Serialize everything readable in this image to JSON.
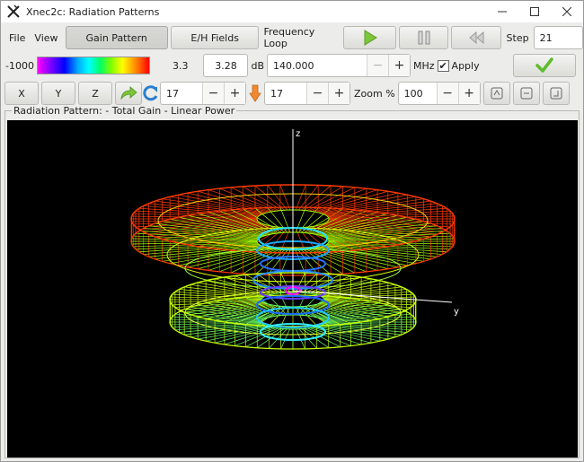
{
  "window": {
    "title": "Xnec2c: Radiation Patterns",
    "app_icon": "xnec2c-icon",
    "controls": [
      "minimize-icon",
      "maximize-icon",
      "close-icon"
    ]
  },
  "menu": {
    "file": "File",
    "view": "View"
  },
  "toolbar": {
    "gain_pattern": "Gain Pattern",
    "eh_fields": "E/H Fields",
    "frequency_loop": "Frequency Loop",
    "play_icon": "play-icon",
    "pause_icon": "pause-icon",
    "rewind_icon": "rewind-icon",
    "step_label": "Step",
    "step_value": "21"
  },
  "scale_row": {
    "min_value": "-1000",
    "max_value": "3.3",
    "gain_value": "3.28",
    "gain_unit": "dB",
    "frequency_value": "140.000",
    "frequency_unit": "MHz",
    "apply_label": "Apply",
    "apply_checked": true,
    "apply_check_mark": "✔",
    "confirm_icon": "checkmark-icon",
    "colors": {
      "confirm": "#5bbd2a"
    }
  },
  "view_row": {
    "x_label": "X",
    "y_label": "Y",
    "z_label": "Z",
    "rotate_icon": "rotate-arrow-icon",
    "refresh_icon": "refresh-icon",
    "rotate_value": "17",
    "incline_icon": "incline-arrow-icon",
    "incline_value": "17",
    "zoom_label": "Zoom %",
    "zoom_value": "100",
    "minus": "−",
    "plus": "+",
    "zoom_in_icon": "zoom-in-icon",
    "zoom_reset_icon": "zoom-reset-icon",
    "zoom_out_icon": "zoom-out-icon"
  },
  "pattern_frame": {
    "label": "Radiation Pattern: - Total Gain - Linear Power",
    "axis_z": "z",
    "axis_y": "y",
    "colors": {
      "background": "#000000",
      "axis": "#ffffff"
    }
  }
}
